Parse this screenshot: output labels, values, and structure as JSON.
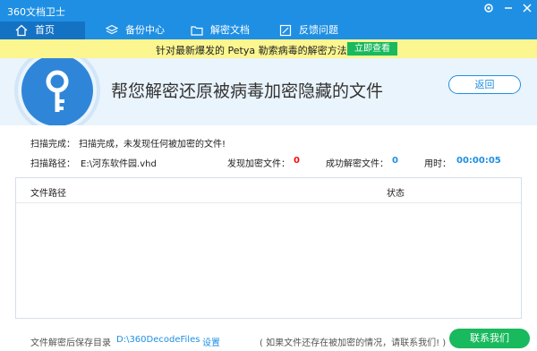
{
  "window": {
    "title": "360文档卫士"
  },
  "nav": {
    "tabs": [
      {
        "label": "首页",
        "icon": "home-icon",
        "active": true
      },
      {
        "label": "备份中心",
        "icon": "layers-icon",
        "active": false
      },
      {
        "label": "解密文档",
        "icon": "folder-icon",
        "active": false
      },
      {
        "label": "反馈问题",
        "icon": "feedback-icon",
        "active": false
      }
    ]
  },
  "banner": {
    "message": "针对最新爆发的 Petya 勒索病毒的解密方法",
    "button": "立即查看"
  },
  "hero": {
    "headline": "帮您解密还原被病毒加密隐藏的文件",
    "back": "返回"
  },
  "scan": {
    "status_label": "扫描完成：",
    "status_value": "扫描完成，未发现任何被加密的文件!",
    "path_label": "扫描路径：",
    "path_value": "E:\\河东软件园.vhd",
    "found_label": "发现加密文件：",
    "found_value": "0",
    "decrypted_label": "成功解密文件：",
    "decrypted_value": "0",
    "time_label": "用时：",
    "time_value": "00:00:05"
  },
  "table": {
    "columns": [
      "文件路径",
      "状态"
    ],
    "rows": []
  },
  "footer": {
    "save_dir_label": "文件解密后保存目录",
    "save_dir_value": "D:\\360DecodeFiles",
    "settings": "设置",
    "hint": "( 如果文件还存在被加密的情况，请联系我们! )",
    "contact": "联系我们"
  },
  "colors": {
    "primary": "#1f8fe3",
    "banner_bg": "#fbf68f",
    "green": "#19b95e",
    "red": "#e11111"
  }
}
